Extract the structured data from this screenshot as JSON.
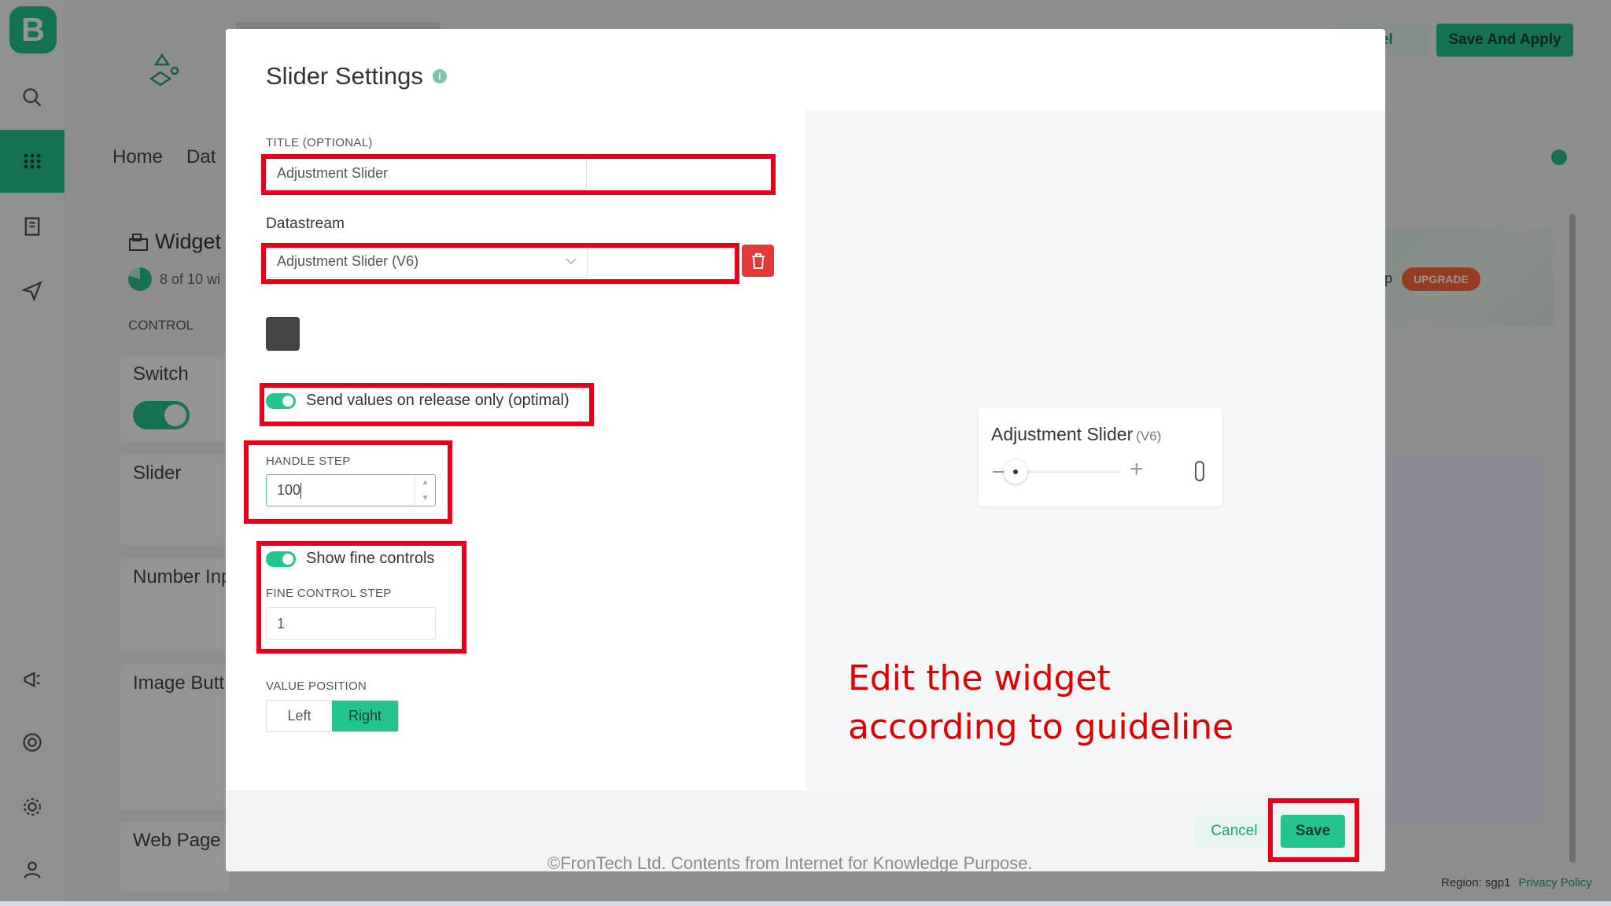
{
  "background": {
    "logo_letter": "B",
    "nav": [
      "Home",
      "Dat"
    ],
    "cancel_top": "cel",
    "save_and_apply": "Save And Apply",
    "widget_box_title": "Widget",
    "widget_count": "8 of 10 wi",
    "section": "CONTROL",
    "cards": [
      "Switch",
      "Slider",
      "Number Inp",
      "Image Butt",
      "Web Page I"
    ],
    "upgrade_tag": "UPGRADE",
    "upgrade_prefix": "p",
    "footer_region": "Region: sgp1",
    "footer_privacy": "Privacy Policy"
  },
  "modal": {
    "title": "Slider Settings",
    "title_field_label": "TITLE (OPTIONAL)",
    "title_field_value": "Adjustment Slider",
    "datastream_label": "Datastream",
    "datastream_value": "Adjustment Slider (V6)",
    "send_on_release_label": "Send values on release only (optimal)",
    "send_on_release_enabled": true,
    "handle_step_label": "HANDLE STEP",
    "handle_step_value": "100",
    "show_fine_controls_label": "Show fine controls",
    "show_fine_controls_enabled": true,
    "fine_step_label": "FINE CONTROL STEP",
    "fine_step_value": "1",
    "value_position_label": "VALUE POSITION",
    "value_position_options": [
      "Left",
      "Right"
    ],
    "value_position_selected": "Right",
    "cancel_label": "Cancel",
    "save_label": "Save"
  },
  "preview": {
    "title": "Adjustment Slider",
    "pin": "(V6)",
    "handle_fraction": 0.0
  },
  "annotation": {
    "line1": "Edit the widget",
    "line2": "according to guideline"
  },
  "watermark": "©FronTech Ltd. Contents from Internet for Knowledge Purpose.",
  "colors": {
    "accent": "#23c48e",
    "highlight": "#e8001a",
    "danger": "#e53935",
    "widget_color": "#444446"
  }
}
